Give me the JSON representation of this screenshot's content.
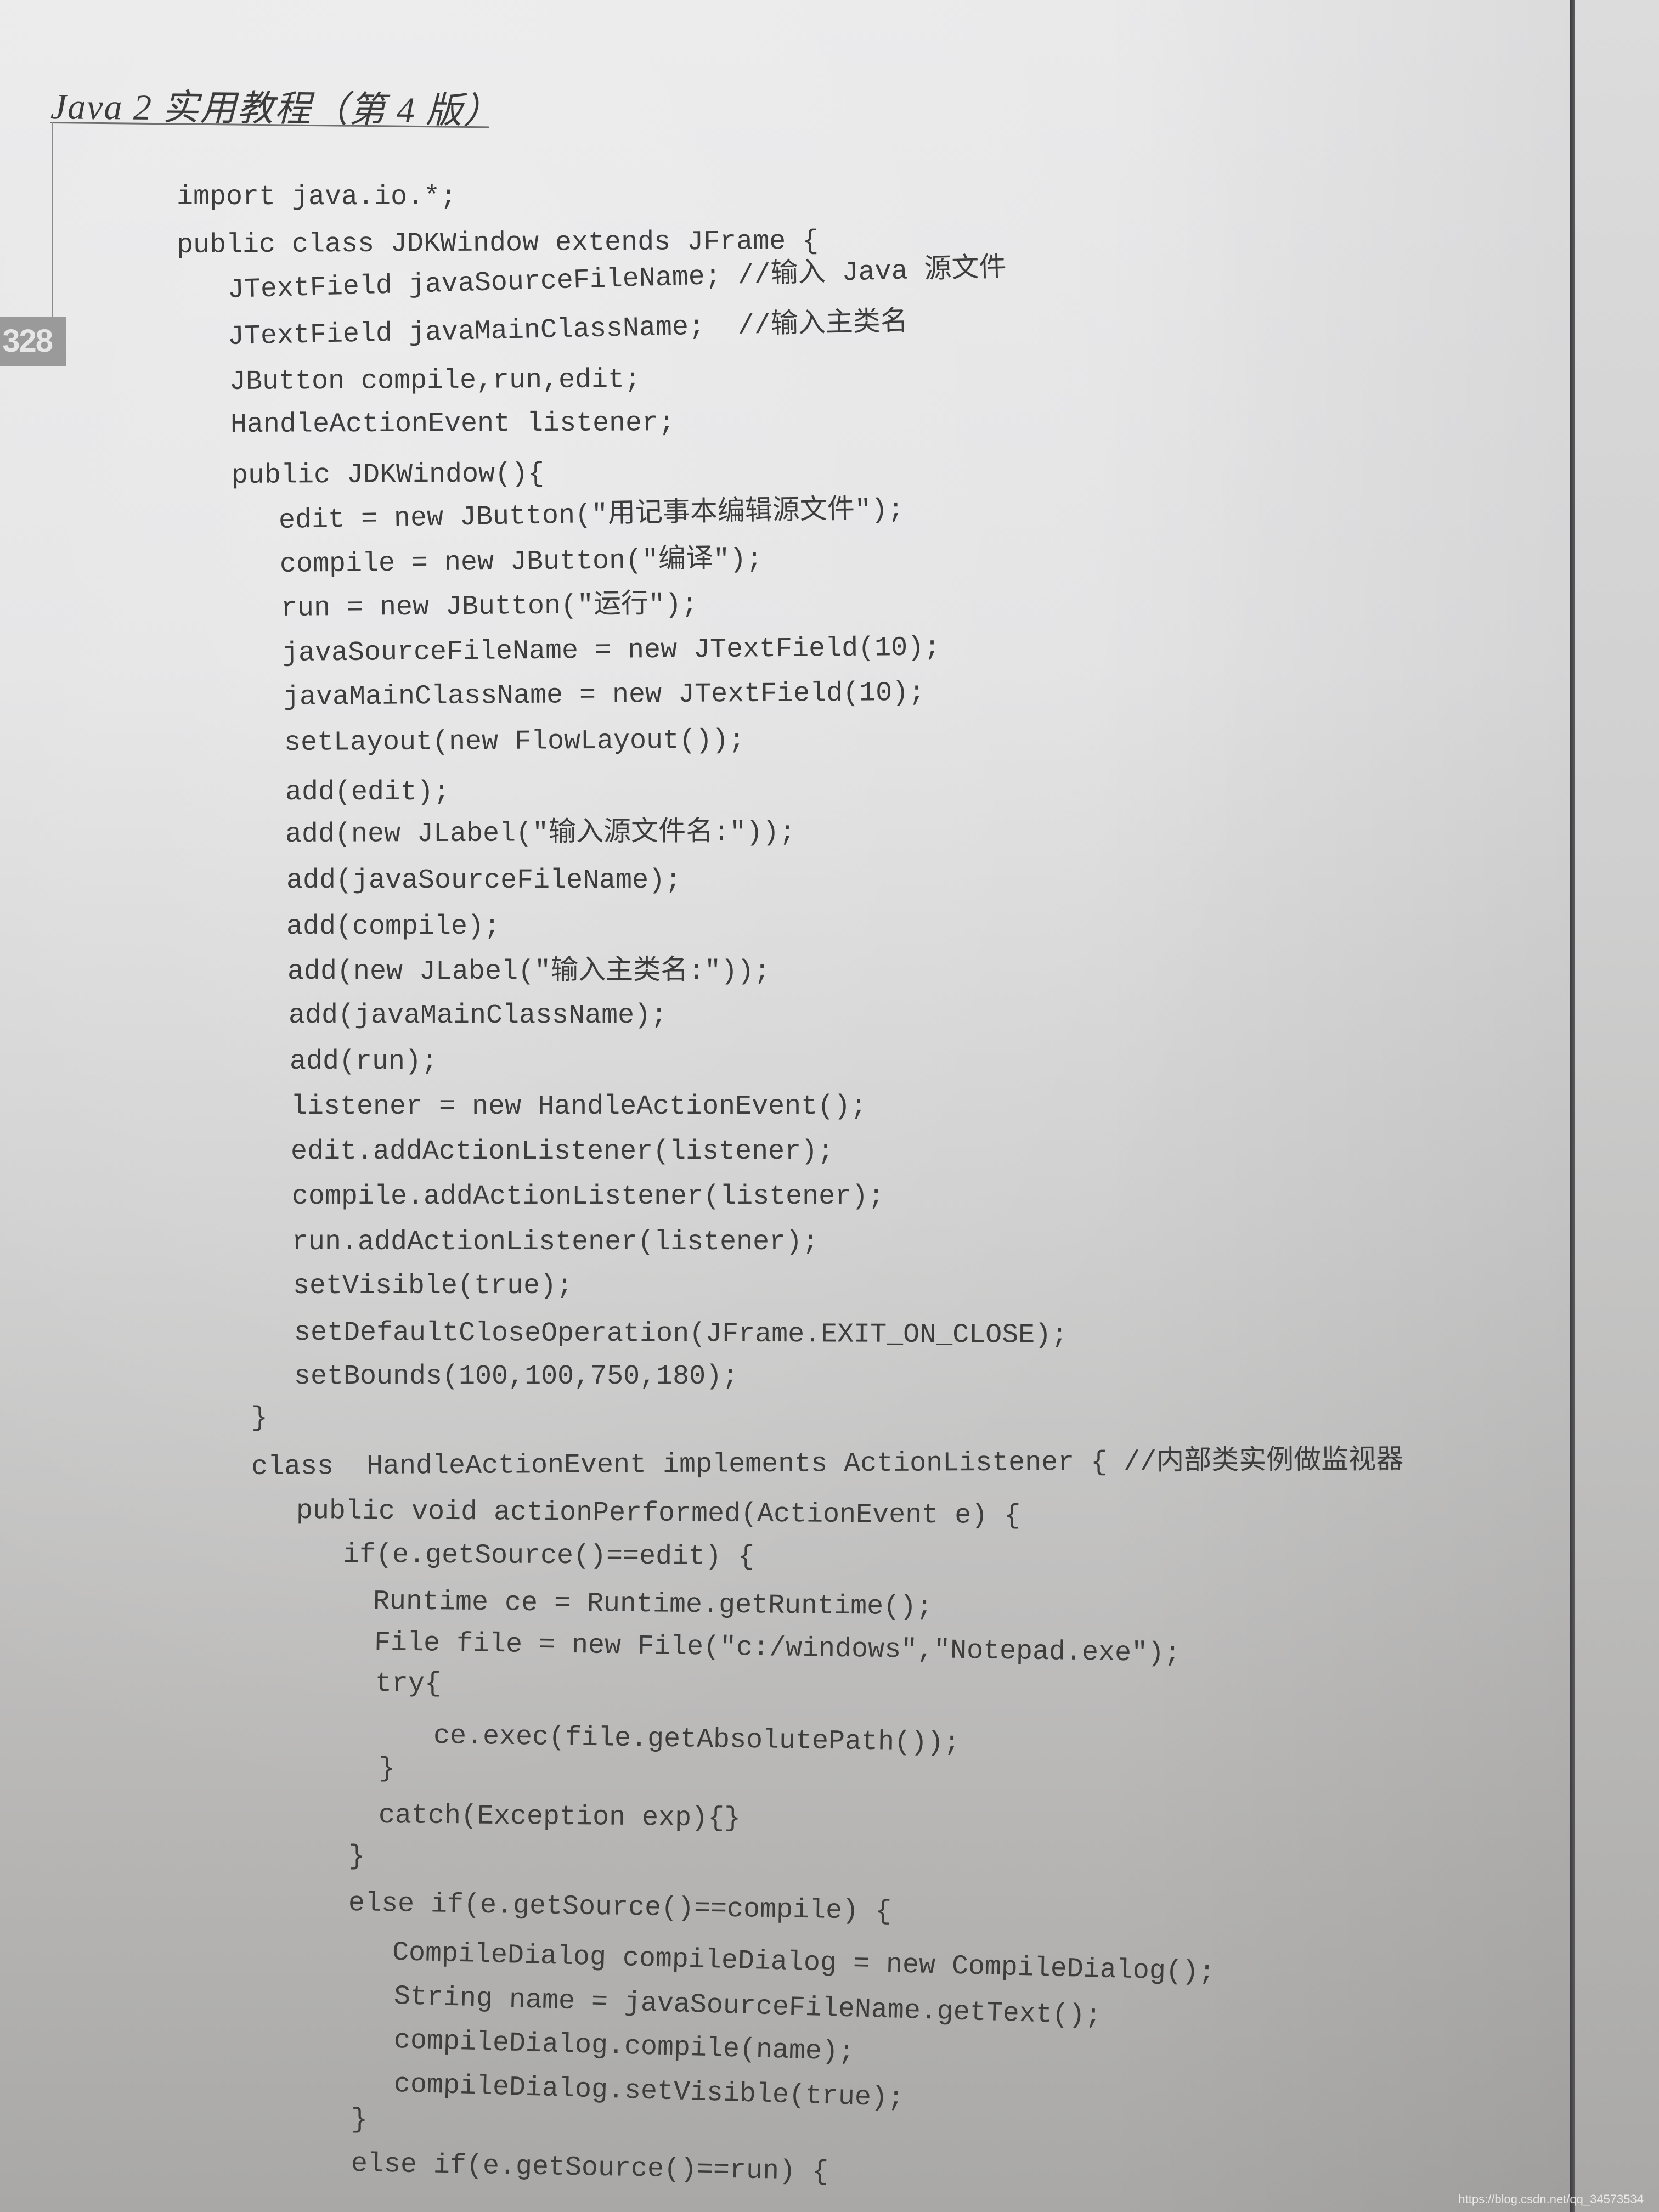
{
  "book": {
    "running_head": "Java 2 实用教程（第 4 版）",
    "page_number": "328"
  },
  "code_lines": [
    "import java.io.*;",
    "public class JDKWindow extends JFrame {",
    "JTextField javaSourceFileName; //输入 Java 源文件",
    "JTextField javaMainClassName;  //输入主类名",
    "JButton compile,run,edit;",
    "HandleActionEvent listener;",
    "public JDKWindow(){",
    "edit = new JButton(\"用记事本编辑源文件\");",
    "compile = new JButton(\"编译\");",
    "run = new JButton(\"运行\");",
    "javaSourceFileName = new JTextField(10);",
    "javaMainClassName = new JTextField(10);",
    "setLayout(new FlowLayout());",
    "add(edit);",
    "add(new JLabel(\"输入源文件名:\"));",
    "add(javaSourceFileName);",
    "add(compile);",
    "add(new JLabel(\"输入主类名:\"));",
    "add(javaMainClassName);",
    "add(run);",
    "listener = new HandleActionEvent();",
    "edit.addActionListener(listener);",
    "compile.addActionListener(listener);",
    "run.addActionListener(listener);",
    "setVisible(true);",
    "setDefaultCloseOperation(JFrame.EXIT_ON_CLOSE);",
    "setBounds(100,100,750,180);",
    "}",
    "class  HandleActionEvent implements ActionListener { //内部类实例做监视器",
    "public void actionPerformed(ActionEvent e) {",
    "if(e.getSource()==edit) {",
    "Runtime ce = Runtime.getRuntime();",
    "File file = new File(\"c:/windows\",\"Notepad.exe\");",
    "try{",
    "ce.exec(file.getAbsolutePath());",
    "}",
    "catch(Exception exp){}",
    "}",
    "else if(e.getSource()==compile) {",
    "CompileDialog compileDialog = new CompileDialog();",
    "String name = javaSourceFileName.getText();",
    "compileDialog.compile(name);",
    "compileDialog.setVisible(true);",
    "}",
    "else if(e.getSource()==run) {"
  ],
  "watermark": "https://blog.csdn.net/qq_34573534"
}
